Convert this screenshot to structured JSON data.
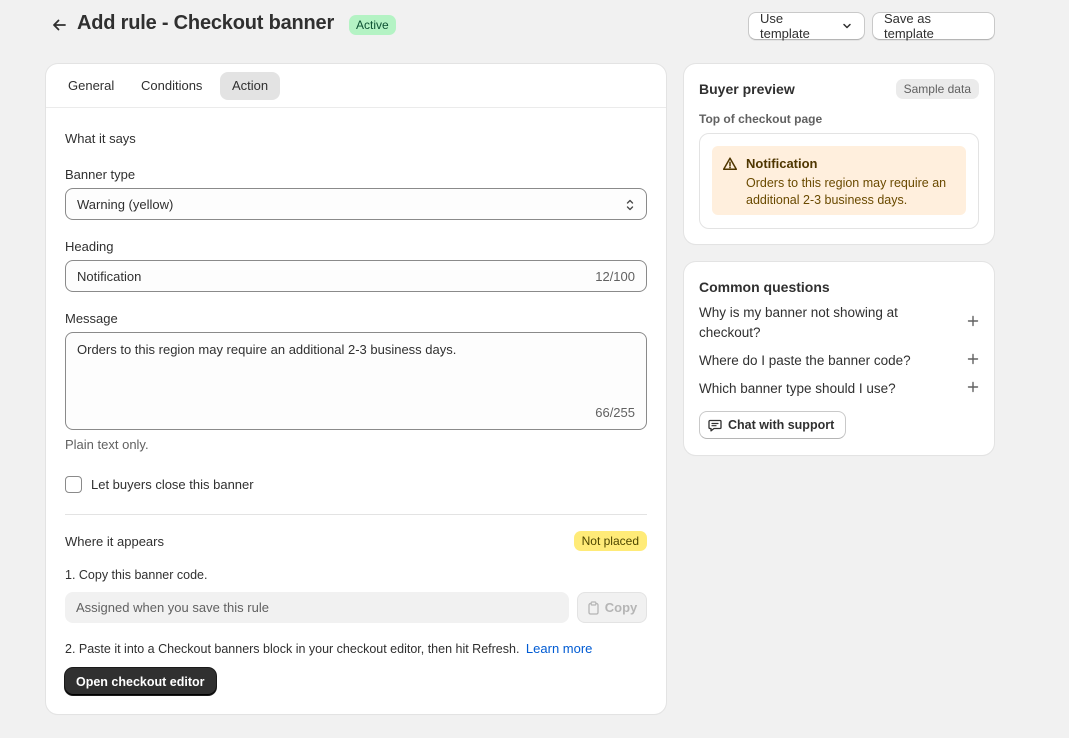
{
  "header": {
    "title": "Add rule - Checkout banner",
    "status_badge": "Active",
    "use_template_label": "Use template",
    "save_template_label": "Save as template"
  },
  "tabs": [
    {
      "label": "General",
      "active": false
    },
    {
      "label": "Conditions",
      "active": false
    },
    {
      "label": "Action",
      "active": true
    }
  ],
  "form": {
    "section_title": "What it says",
    "banner_type_label": "Banner type",
    "banner_type_value": "Warning (yellow)",
    "heading_label": "Heading",
    "heading_value": "Notification",
    "heading_counter": "12/100",
    "message_label": "Message",
    "message_value": "Orders to this region may require an additional 2-3 business days.",
    "message_counter": "66/255",
    "message_help": "Plain text only.",
    "close_checkbox_label": "Let buyers close this banner",
    "close_checkbox_checked": false
  },
  "placement": {
    "section_title": "Where it appears",
    "status_badge": "Not placed",
    "step1": "1. Copy this banner code.",
    "code_placeholder": "Assigned when you save this rule",
    "copy_label": "Copy",
    "step2": "2. Paste it into a Checkout banners block in your checkout editor, then hit Refresh.",
    "learn_more": "Learn more",
    "open_editor_label": "Open checkout editor"
  },
  "preview": {
    "title": "Buyer preview",
    "badge": "Sample data",
    "subheading": "Top of checkout page",
    "banner_heading": "Notification",
    "banner_message": "Orders to this region may require an additional 2-3 business days.",
    "banner_icon": "warning-triangle-icon"
  },
  "faq": {
    "title": "Common questions",
    "items": [
      {
        "question": "Why is my banner not showing at checkout?"
      },
      {
        "question": "Where do I paste the banner code?"
      },
      {
        "question": "Which banner type should I use?"
      }
    ],
    "chat_label": "Chat with support"
  },
  "colors": {
    "page_bg": "#f1f1f1",
    "active_badge_bg": "#b4f3c4",
    "warning_badge_bg": "#ffeb78",
    "banner_bg": "#ffefdd",
    "link": "#005bd3",
    "primary_button": "#303030"
  }
}
